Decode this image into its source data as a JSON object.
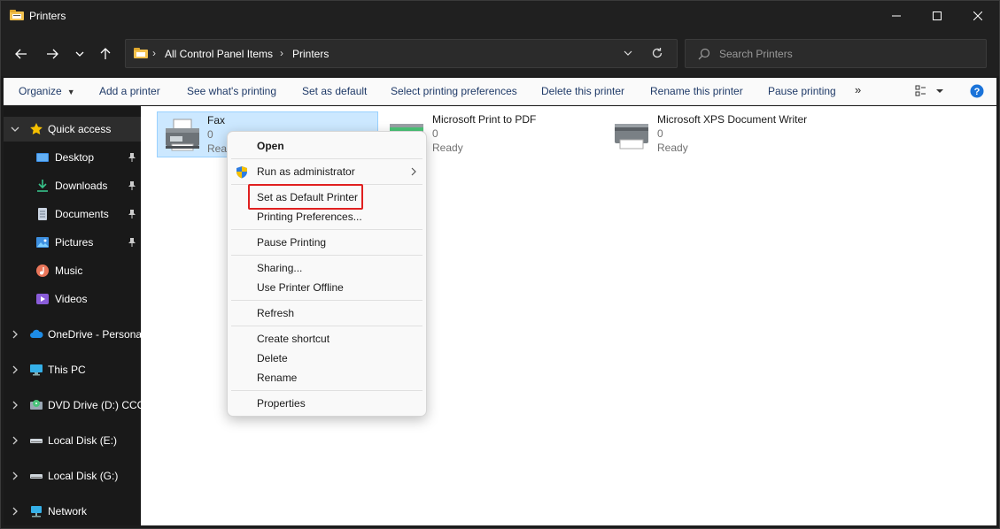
{
  "window": {
    "title": "Printers"
  },
  "address": {
    "crumbs": [
      "All Control Panel Items",
      "Printers"
    ]
  },
  "search": {
    "placeholder": "Search Printers"
  },
  "toolbar": {
    "organize": "Organize",
    "add_printer": "Add a printer",
    "see_printing": "See what's printing",
    "set_default": "Set as default",
    "printing_prefs": "Select printing preferences",
    "delete_printer": "Delete this printer",
    "rename_printer": "Rename this printer",
    "pause_printing": "Pause printing",
    "more": "»"
  },
  "sidebar": {
    "items": [
      {
        "label": "Quick access",
        "icon": "star-icon"
      },
      {
        "label": "Desktop",
        "icon": "desktop-icon"
      },
      {
        "label": "Downloads",
        "icon": "downloads-icon"
      },
      {
        "label": "Documents",
        "icon": "documents-icon"
      },
      {
        "label": "Pictures",
        "icon": "pictures-icon"
      },
      {
        "label": "Music",
        "icon": "music-icon"
      },
      {
        "label": "Videos",
        "icon": "videos-icon"
      },
      {
        "label": "OneDrive - Personal",
        "icon": "onedrive-icon"
      },
      {
        "label": "This PC",
        "icon": "this-pc-icon"
      },
      {
        "label": "DVD Drive (D:) CCCC",
        "icon": "dvd-drive-icon"
      },
      {
        "label": "Local Disk (E:)",
        "icon": "disk-icon"
      },
      {
        "label": "Local Disk (G:)",
        "icon": "disk-icon"
      },
      {
        "label": "Network",
        "icon": "network-icon"
      }
    ]
  },
  "printers": [
    {
      "name": "Fax",
      "count": "0",
      "status": "Ready"
    },
    {
      "name": "Microsoft Print to PDF",
      "count": "0",
      "status": "Ready"
    },
    {
      "name": "Microsoft XPS Document Writer",
      "count": "0",
      "status": "Ready"
    }
  ],
  "context_menu": {
    "items": [
      "Open",
      "Run as administrator",
      "Set as Default Printer",
      "Printing Preferences...",
      "Pause Printing",
      "Sharing...",
      "Use Printer Offline",
      "Refresh",
      "Create shortcut",
      "Delete",
      "Rename",
      "Properties"
    ],
    "highlight_color": "#e02020"
  },
  "colors": {
    "accent": "#0078d4",
    "selection": "#cce8ff",
    "toolbar_text": "#1f3a68"
  }
}
